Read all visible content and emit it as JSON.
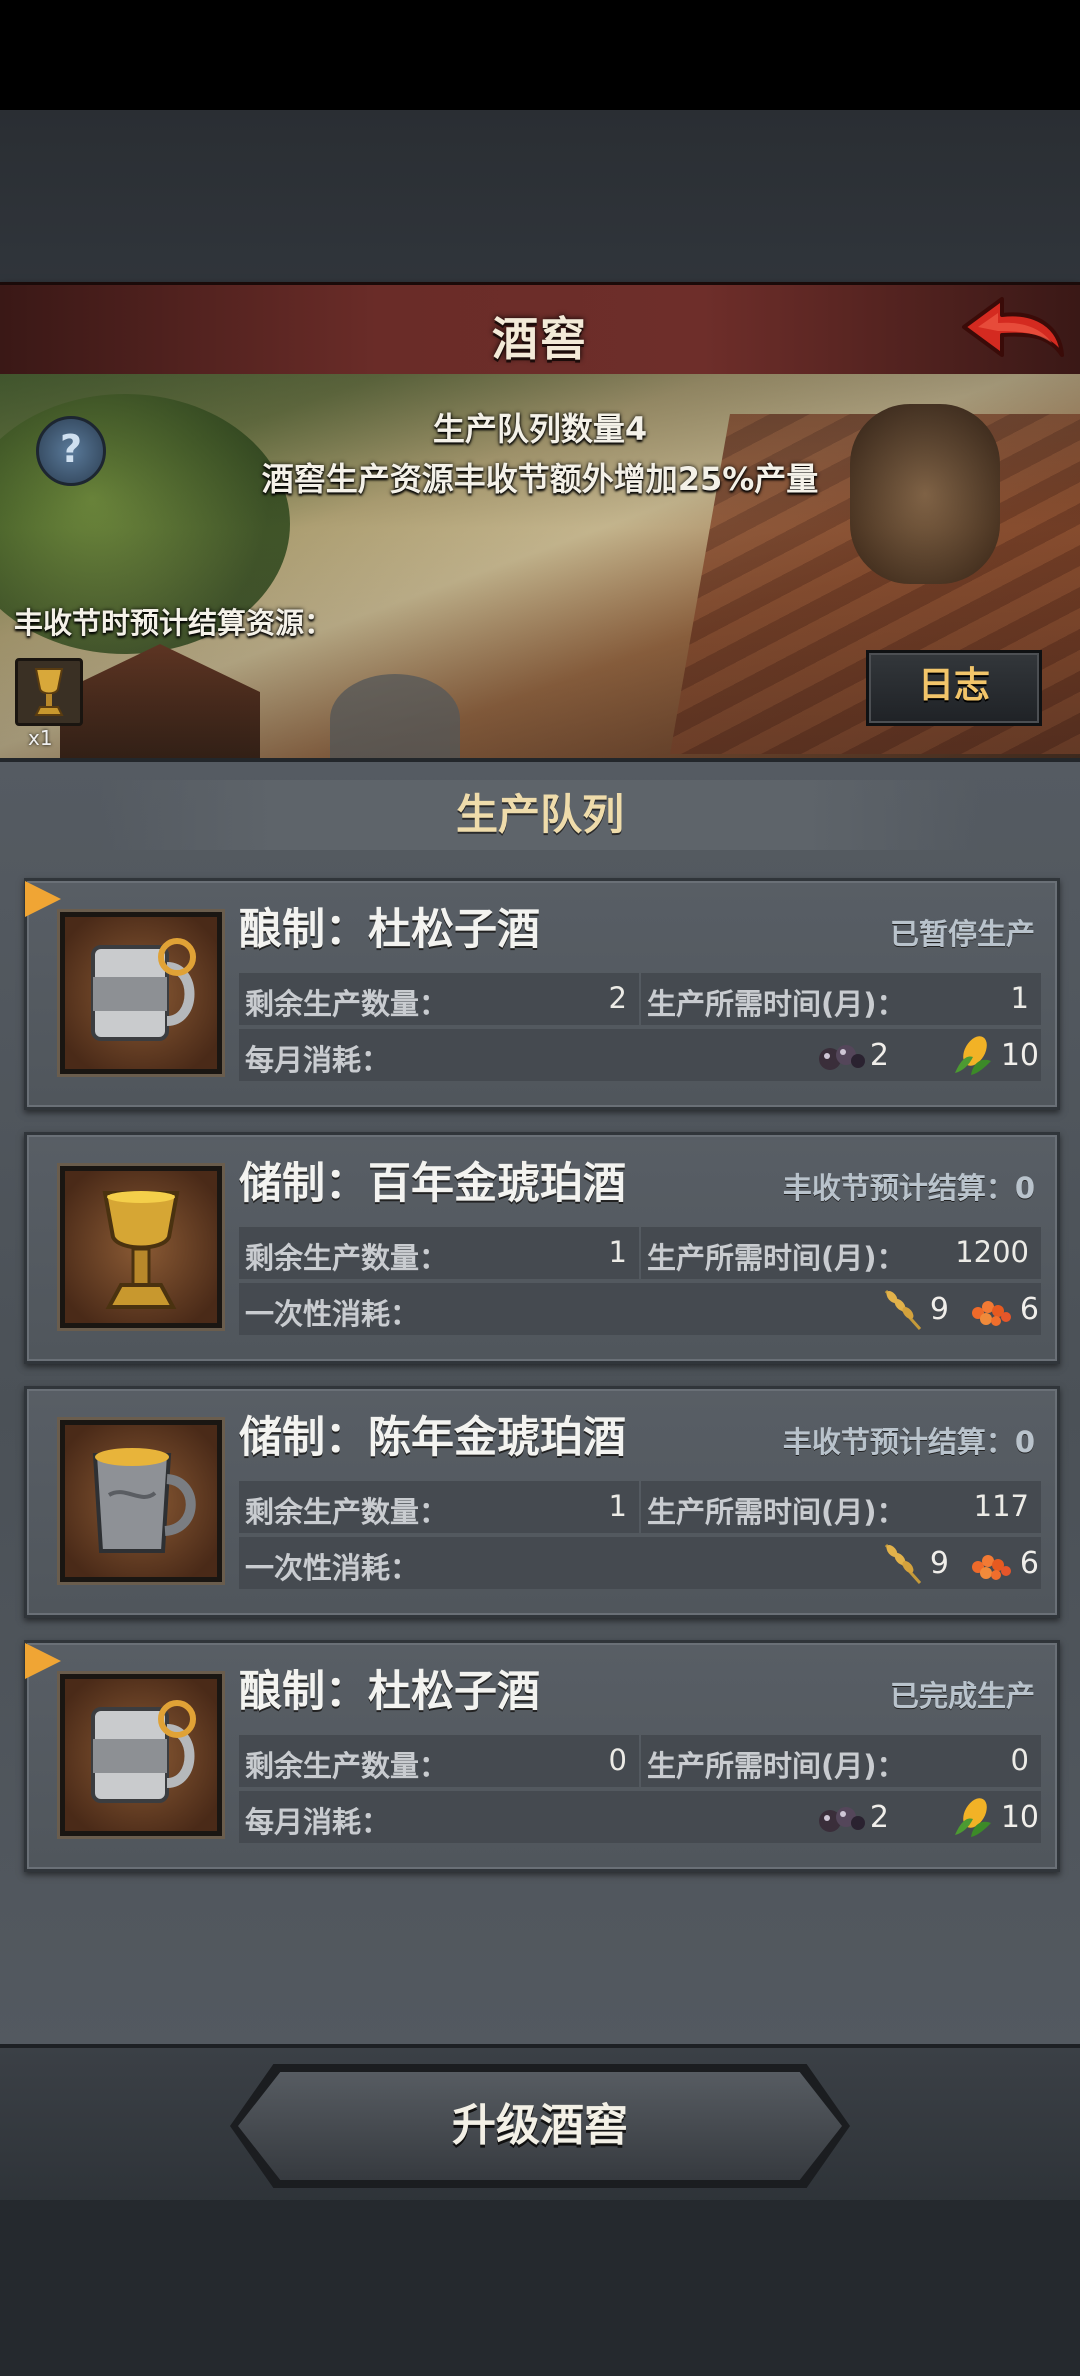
{
  "header": {
    "title": "酒窖"
  },
  "banner": {
    "queue_count_text": "生产队列数量4",
    "bonus_text": "酒窖生产资源丰收节额外增加25%产量",
    "harvest_label": "丰收节时预计结算资源：",
    "harvest_item_count": "x1",
    "log_button": "日志"
  },
  "queue": {
    "title": "生产队列",
    "cards": [
      {
        "name": "酿制：杜松子酒",
        "status": "已暂停生产",
        "remaining_label": "剩余生产数量：",
        "remaining": "2",
        "time_label": "生产所需时间(月)：",
        "time": "1",
        "consume_label": "每月消耗：",
        "resources": [
          {
            "icon": "berries-icon",
            "amount": "2"
          },
          {
            "icon": "corn-icon",
            "amount": "10"
          }
        ]
      },
      {
        "name": "储制：百年金琥珀酒",
        "status": "丰收节预计结算：0",
        "remaining_label": "剩余生产数量：",
        "remaining": "1",
        "time_label": "生产所需时间(月)：",
        "time": "1200",
        "consume_label": "一次性消耗：",
        "resources": [
          {
            "icon": "wheat-icon",
            "amount": "9"
          },
          {
            "icon": "roe-icon",
            "amount": "6"
          }
        ]
      },
      {
        "name": "储制：陈年金琥珀酒",
        "status": "丰收节预计结算：0",
        "remaining_label": "剩余生产数量：",
        "remaining": "1",
        "time_label": "生产所需时间(月)：",
        "time": "117",
        "consume_label": "一次性消耗：",
        "resources": [
          {
            "icon": "wheat-icon",
            "amount": "9"
          },
          {
            "icon": "roe-icon",
            "amount": "6"
          }
        ]
      },
      {
        "name": "酿制：杜松子酒",
        "status": "已完成生产",
        "remaining_label": "剩余生产数量：",
        "remaining": "0",
        "time_label": "生产所需时间(月)：",
        "time": "0",
        "consume_label": "每月消耗：",
        "resources": [
          {
            "icon": "berries-icon",
            "amount": "2"
          },
          {
            "icon": "corn-icon",
            "amount": "10"
          }
        ]
      }
    ]
  },
  "upgrade_button": "升级酒窖",
  "colors": {
    "accent_gold": "#efdcab",
    "log_text": "#f2c56a",
    "header_red": "#6a2c28",
    "flag_orange": "#f0a534"
  }
}
